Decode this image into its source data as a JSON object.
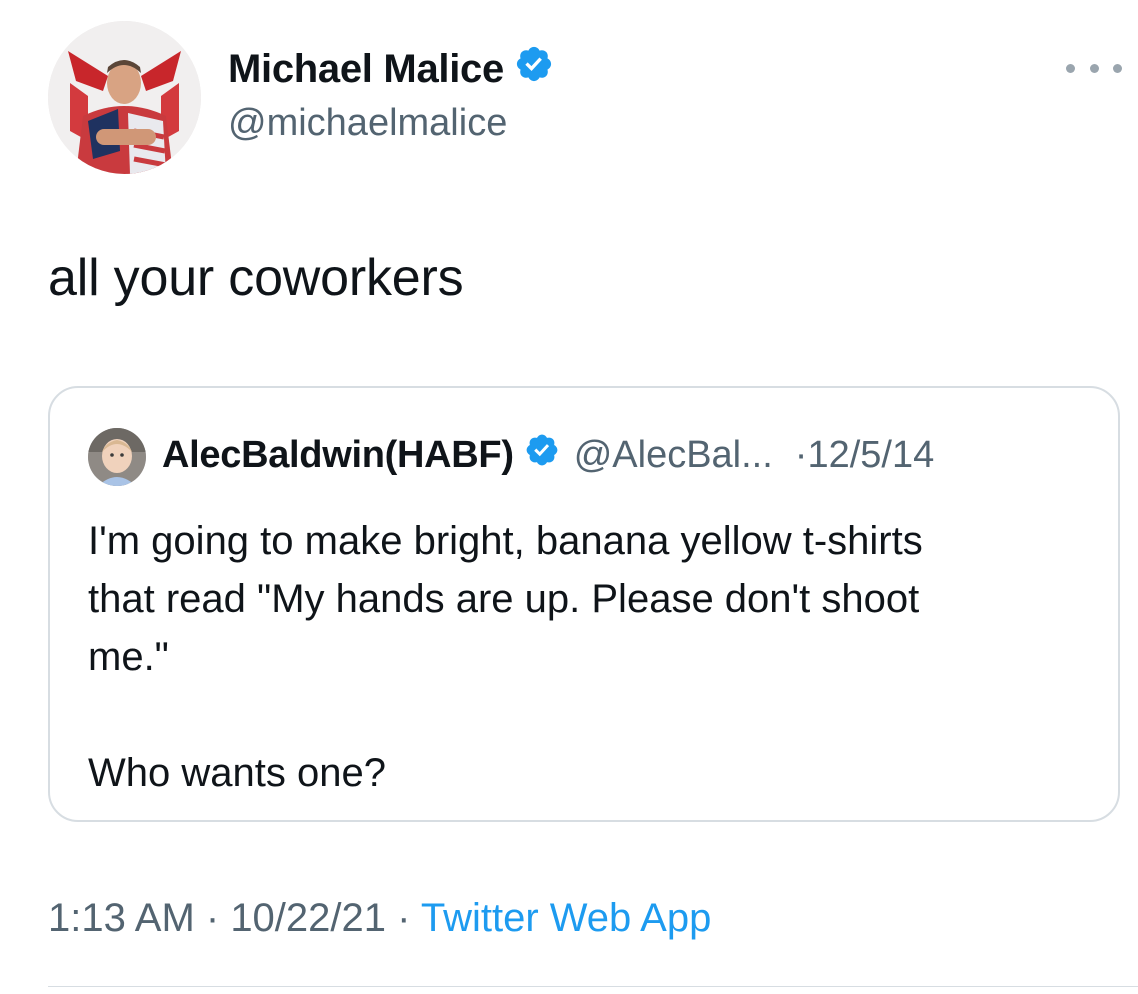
{
  "author": {
    "display_name": "Michael Malice",
    "handle": "@michaelmalice",
    "verified_icon": "verified-badge-icon"
  },
  "tweet": {
    "text": "all your coworkers"
  },
  "quoted_tweet": {
    "display_name": "AlecBaldwin(HABF)",
    "handle": "@AlecBal...",
    "separator": "·",
    "date": "12/5/14",
    "text": "I'm going to make bright, banana yellow t-shirts\nthat read \"My hands are up. Please don't shoot\nme.\"\n\nWho wants one?"
  },
  "footer": {
    "time": "1:13 AM",
    "sep1": " · ",
    "date": "10/22/21",
    "sep2": " · ",
    "source": "Twitter Web App"
  },
  "colors": {
    "text": "#0f1419",
    "secondary": "#536471",
    "accent": "#1d9bf0",
    "border": "#d7dde2"
  }
}
